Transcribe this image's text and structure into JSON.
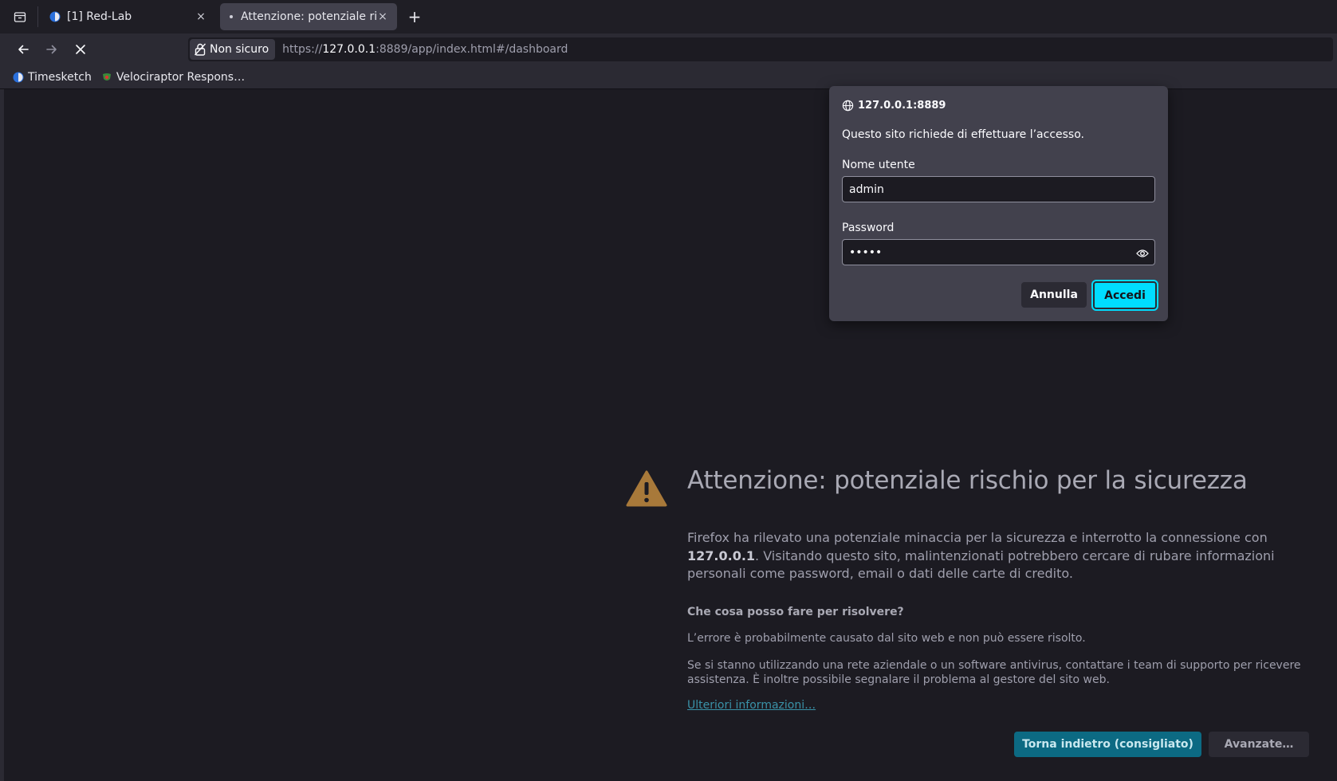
{
  "browser": {
    "tabs": [
      {
        "title": "[1] Red-Lab",
        "active": false
      },
      {
        "title": "Attenzione: potenziale ris",
        "active": true
      }
    ],
    "new_tab_label": "+",
    "close_glyph": "×",
    "url": {
      "security_label": "Non sicuro",
      "scheme": "https://",
      "host": "127.0.0.1",
      "rest": ":8889/app/index.html#/dashboard"
    },
    "bookmarks": [
      {
        "label": "Timesketch",
        "icon": "timesketch-favicon"
      },
      {
        "label": "Velociraptor Respons…",
        "icon": "velociraptor-favicon"
      }
    ]
  },
  "auth_dialog": {
    "origin": "127.0.0.1:8889",
    "message": "Questo sito richiede di effettuare l’accesso.",
    "username_label": "Nome utente",
    "username_value": "admin",
    "password_label": "Password",
    "password_value": "•••••",
    "cancel_label": "Annulla",
    "submit_label": "Accedi"
  },
  "error_page": {
    "title": "Attenzione: potenziale rischio per la sicurezza",
    "description_prefix": "Firefox ha rilevato una potenziale minaccia per la sicurezza e interrotto la connessione con ",
    "description_host": "127.0.0.1",
    "description_suffix": ". Visitando questo sito, malintenzionati potrebbero cercare di rubare informazioni personali come password, email o dati delle carte di credito.",
    "subtitle": "Che cosa posso fare per risolvere?",
    "text1": "L’errore è probabilmente causato dal sito web e non può essere risolto.",
    "text2": "Se si stanno utilizzando una rete aziendale o un software antivirus, contattare i team di supporto per ricevere assistenza. È inoltre possibile segnalare il problema al gestore del sito web.",
    "learn_more": "Ulteriori informazioni…",
    "back_button": "Torna indietro (consigliato)",
    "advanced_button": "Avanzate…"
  },
  "colors": {
    "page_bg": "#1c1b22",
    "dialog_bg": "#42414d",
    "accent": "#00ddff",
    "primary_button": "#0c6a83",
    "warning_icon": "#a8793a",
    "link": "#3a92a8"
  }
}
